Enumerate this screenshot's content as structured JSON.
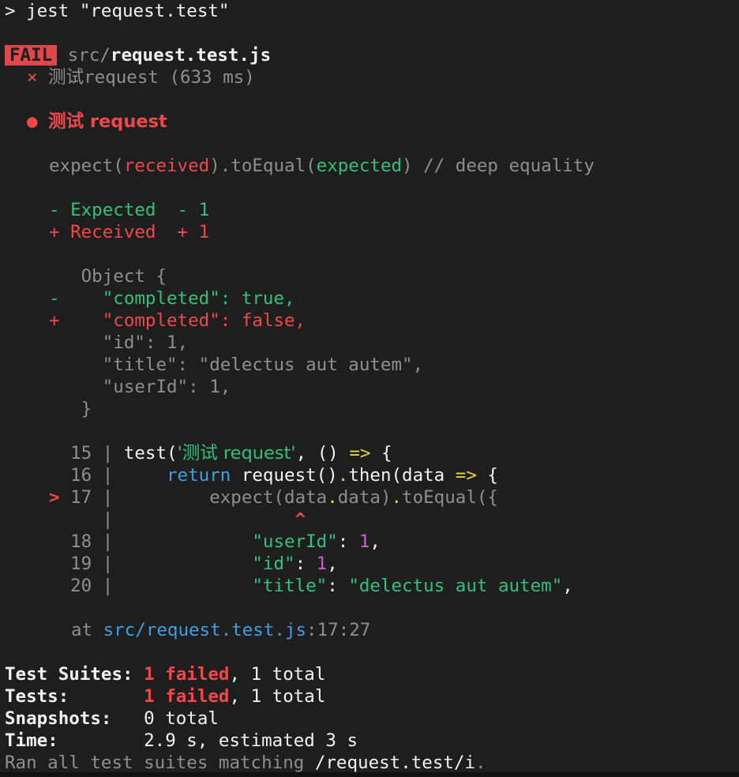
{
  "command": {
    "prompt": ">",
    "text": "jest \"request.test\""
  },
  "result_header": {
    "badge": "FAIL",
    "path_dir": "src/",
    "path_file": "request.test.js"
  },
  "test_list": [
    {
      "mark": "×",
      "name": "测试",
      "name_suffix": "request",
      "duration": "(633 ms)"
    }
  ],
  "failure": {
    "bullet": "●",
    "title": "测试 request",
    "assertion": {
      "prefix": "expect(",
      "received": "received",
      "mid": ").toEqual(",
      "expected": "expected",
      "suffix": ")",
      "comment": " // deep equality"
    },
    "legend": {
      "expected": "- Expected  - 1",
      "received": "+ Received  + 1"
    },
    "diff": [
      {
        "sign": " ",
        "text": "  Object {",
        "kind": "same"
      },
      {
        "sign": "-",
        "text": "    \"completed\": true,",
        "kind": "removed"
      },
      {
        "sign": "+",
        "text": "    \"completed\": false,",
        "kind": "added"
      },
      {
        "sign": " ",
        "text": "    \"id\": 1,",
        "kind": "same"
      },
      {
        "sign": " ",
        "text": "    \"title\": \"delectus aut autem\",",
        "kind": "same"
      },
      {
        "sign": " ",
        "text": "    \"userId\": 1,",
        "kind": "same"
      },
      {
        "sign": " ",
        "text": "  }",
        "kind": "same"
      }
    ],
    "code_frame": {
      "l15_num": "15",
      "l15_a": "test(",
      "l15_str": "'测试 request'",
      "l15_b": ", () ",
      "l15_arrow": "=>",
      "l15_c": " {",
      "l16_num": "16",
      "l16_kw": "return",
      "l16_a": " request()",
      "l16_dot": ".",
      "l16_b": "then(data ",
      "l16_arrow": "=>",
      "l16_c": " {",
      "l17_marker": ">",
      "l17_num": "17",
      "l17_a": "expect(data",
      "l17_dot1": ".",
      "l17_b": "data)",
      "l17_dot2": ".",
      "l17_c": "toEqual({",
      "caret": "^",
      "l18_num": "18",
      "l18_key": "\"userId\"",
      "l18_colon": ": ",
      "l18_val": "1",
      "l18_end": ",",
      "l19_num": "19",
      "l19_key": "\"id\"",
      "l19_colon": ": ",
      "l19_val": "1",
      "l19_end": ",",
      "l20_num": "20",
      "l20_key": "\"title\"",
      "l20_colon": ": ",
      "l20_val": "\"delectus aut autem\"",
      "l20_end": ","
    },
    "location": {
      "at": "at ",
      "file": "src/request.test.js",
      "pos": ":17:27"
    }
  },
  "summary": {
    "suites_label": "Test Suites:",
    "suites_failed": "1 failed",
    "suites_total": ", 1 total",
    "tests_label": "Tests:",
    "tests_failed": "1 failed",
    "tests_total": ", 1 total",
    "snapshots_label": "Snapshots:",
    "snapshots_value": "0 total",
    "time_label": "Time:",
    "time_value": "2.9 s, estimated 3 s",
    "ran_text": "Ran all test suites matching",
    "ran_pattern": "/request.test/i",
    "ran_end": "."
  },
  "colors": {
    "background": "#1e1e1e",
    "fail_badge": "#e0464a",
    "red": "#f0474a",
    "green": "#32c07d",
    "yellow": "#e6d63b",
    "blue": "#3aa0e3",
    "magenta": "#d25bc9"
  }
}
